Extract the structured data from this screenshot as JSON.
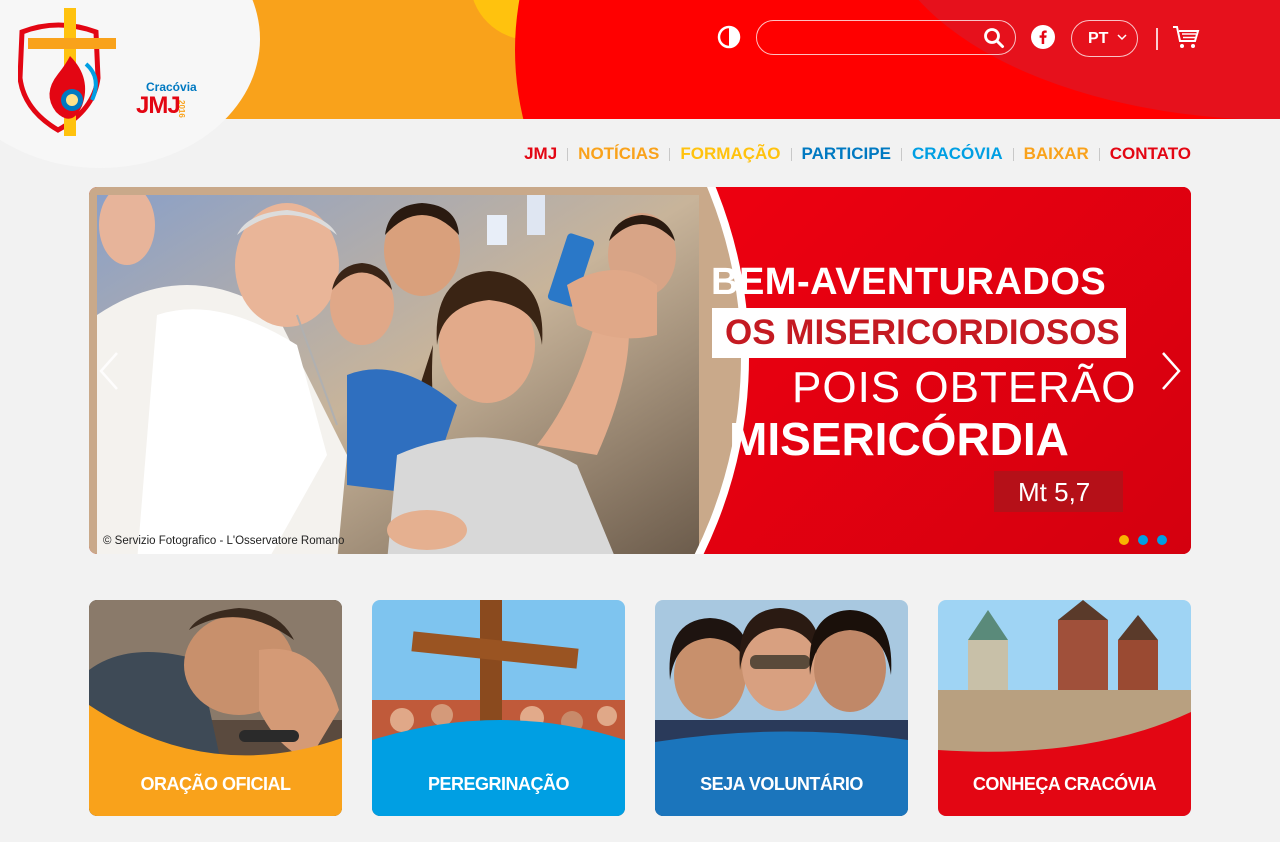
{
  "header": {
    "logo": {
      "city": "Cracóvia",
      "brand": "JMJ",
      "year": "2016"
    },
    "search": {
      "placeholder": "",
      "value": ""
    },
    "language": "PT",
    "icons": [
      "contrast-icon",
      "search-icon",
      "facebook-icon",
      "chevron-down-icon",
      "cart-icon"
    ]
  },
  "nav": {
    "items": [
      {
        "label": "JMJ",
        "color": "#e30613"
      },
      {
        "label": "NOTÍCIAS",
        "color": "#f9a21b"
      },
      {
        "label": "FORMAÇÃO",
        "color": "#ffc20e"
      },
      {
        "label": "PARTICIPE",
        "color": "#0079c1"
      },
      {
        "label": "CRACÓVIA",
        "color": "#009fe3"
      },
      {
        "label": "BAIXAR",
        "color": "#f9a21b"
      },
      {
        "label": "CONTATO",
        "color": "#e30613"
      }
    ]
  },
  "slider": {
    "line1": "BEM-AVENTURADOS",
    "line2": "OS MISERICORDIOSOS",
    "line3": "POIS OBTERÃO",
    "line4": "MISERICÓRDIA",
    "reference": "Mt 5,7",
    "credit": "© Servizio Fotografico - L'Osservatore Romano",
    "dots": [
      "#f9b400",
      "#009fe3",
      "#009fe3"
    ]
  },
  "cards": [
    {
      "label": "ORAÇÃO OFICIAL",
      "color": "#f9a21b"
    },
    {
      "label": "PEREGRINAÇÃO",
      "color": "#009fe3"
    },
    {
      "label": "SEJA VOLUNTÁRIO",
      "color": "#1b75bc"
    },
    {
      "label": "CONHEÇA CRACÓVIA",
      "color": "#e30613"
    }
  ],
  "colors": {
    "orange": "#f9a21b",
    "red": "#ff0000",
    "yellow": "#ffc20e",
    "blue": "#0079c1",
    "lightblue": "#009fe3"
  }
}
